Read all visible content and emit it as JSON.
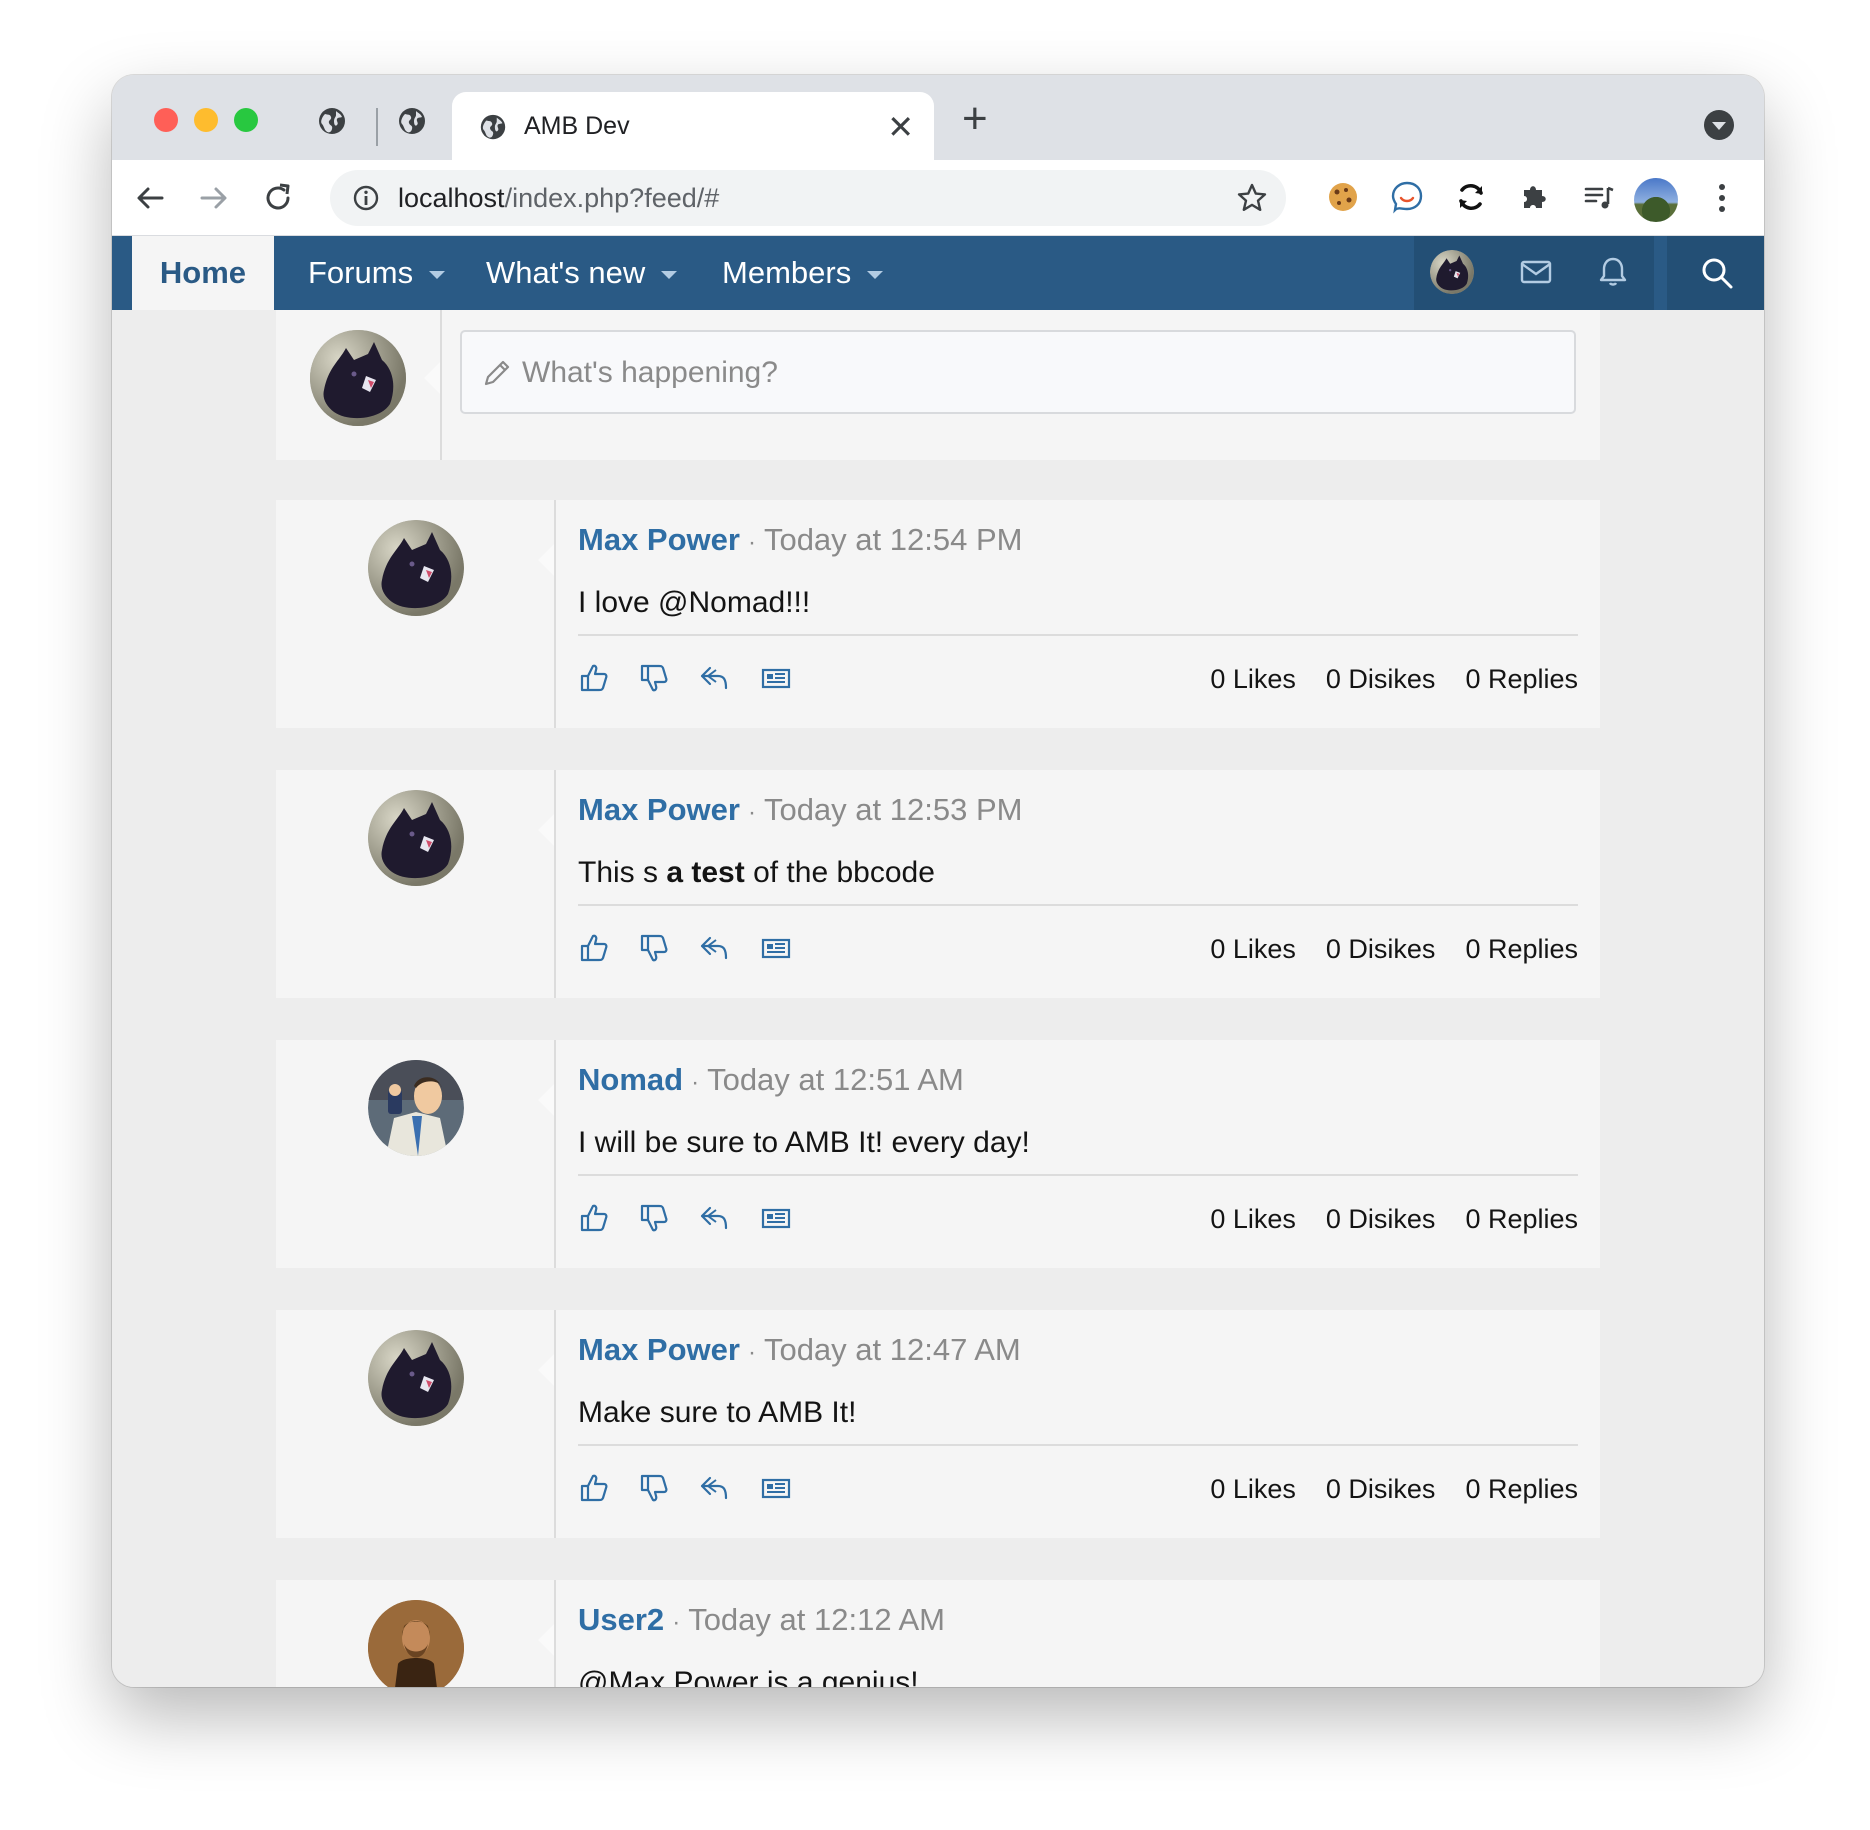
{
  "browser": {
    "tab_title": "AMB Dev",
    "tab_close": "✕",
    "new_tab": "+",
    "url_host": "localhost",
    "url_path": "/index.php?feed/#"
  },
  "nav": {
    "home": "Home",
    "items": [
      {
        "label": "Forums"
      },
      {
        "label": "What's new"
      },
      {
        "label": "Members"
      }
    ]
  },
  "composer": {
    "placeholder": "What's happening?"
  },
  "posts": [
    {
      "author": "Max Power",
      "sep": "·",
      "time": "Today at 12:54 PM",
      "body": "I love @Nomad!!!",
      "likes": "0 Likes",
      "dislikes": "0 Disikes",
      "replies": "0 Replies",
      "avatar": "black-cat"
    },
    {
      "author": "Max Power",
      "sep": "·",
      "time": "Today at 12:53 PM",
      "body_pre": "This s ",
      "body_bold": "a test",
      "body_post": " of the bbcode",
      "likes": "0 Likes",
      "dislikes": "0 Disikes",
      "replies": "0 Replies",
      "avatar": "black-cat"
    },
    {
      "author": "Nomad",
      "sep": "·",
      "time": "Today at 12:51 AM",
      "body": "I will be sure to AMB It! every day!",
      "likes": "0 Likes",
      "dislikes": "0 Disikes",
      "replies": "0 Replies",
      "avatar": "cartoon-man"
    },
    {
      "author": "Max Power",
      "sep": "·",
      "time": "Today at 12:47 AM",
      "body": "Make sure to AMB It!",
      "likes": "0 Likes",
      "dislikes": "0 Disikes",
      "replies": "0 Replies",
      "avatar": "black-cat"
    },
    {
      "author": "User2",
      "sep": "·",
      "time": "Today at 12:12 AM",
      "body": "@Max Power is a genius!",
      "avatar": "bearded-man"
    }
  ],
  "colors": {
    "nav_bg": "#2a5a85",
    "accent_link": "#2f6ea5",
    "page_bg": "#ededed",
    "card_bg": "#f5f5f5"
  },
  "icons": [
    "globe-icon",
    "back-arrow-icon",
    "forward-arrow-icon",
    "reload-icon",
    "info-icon",
    "star-icon",
    "cookie-icon",
    "speech-bubble-icon",
    "sync-icon",
    "puzzle-icon",
    "media-queue-icon",
    "kebab-menu-icon",
    "envelope-icon",
    "bell-icon",
    "search-icon",
    "pencil-icon",
    "thumbs-up-icon",
    "thumbs-down-icon",
    "reply-icon",
    "news-card-icon"
  ]
}
